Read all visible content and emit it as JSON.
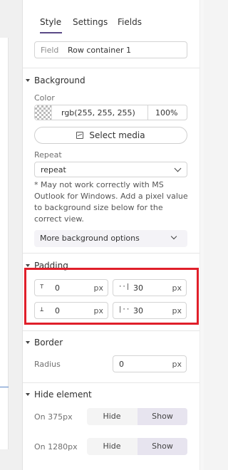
{
  "tabs": [
    "Style",
    "Settings",
    "Fields"
  ],
  "field": {
    "label": "Field",
    "value": "Row container 1"
  },
  "background": {
    "title": "Background",
    "color_label": "Color",
    "color_value": "rgb(255, 255, 255)",
    "opacity": "100%",
    "media_button": "Select media",
    "repeat_label": "Repeat",
    "repeat_value": "repeat",
    "note": "* May not work correctly with MS Outlook for Windows. Add a pixel value to background size below for the correct view.",
    "more_options": "More background options"
  },
  "padding": {
    "title": "Padding",
    "top": {
      "icon": "padding-top-icon",
      "value": "0",
      "unit": "px"
    },
    "right": {
      "icon": "padding-right-icon",
      "value": "30",
      "unit": "px"
    },
    "bottom": {
      "icon": "padding-bottom-icon",
      "value": "0",
      "unit": "px"
    },
    "left": {
      "icon": "padding-left-icon",
      "value": "30",
      "unit": "px"
    }
  },
  "border": {
    "title": "Border",
    "radius_label": "Radius",
    "radius_value": "0",
    "unit": "px"
  },
  "hide": {
    "title": "Hide element",
    "rows": [
      {
        "label": "On 375px",
        "hide": "Hide",
        "show": "Show",
        "selected": "Show"
      },
      {
        "label": "On 1280px",
        "hide": "Hide",
        "show": "Show",
        "selected": "Show"
      }
    ]
  },
  "colors": {
    "accent": "#5a4a86",
    "highlight": "#e01f2a",
    "toggle_on": "#e7e4ef"
  }
}
